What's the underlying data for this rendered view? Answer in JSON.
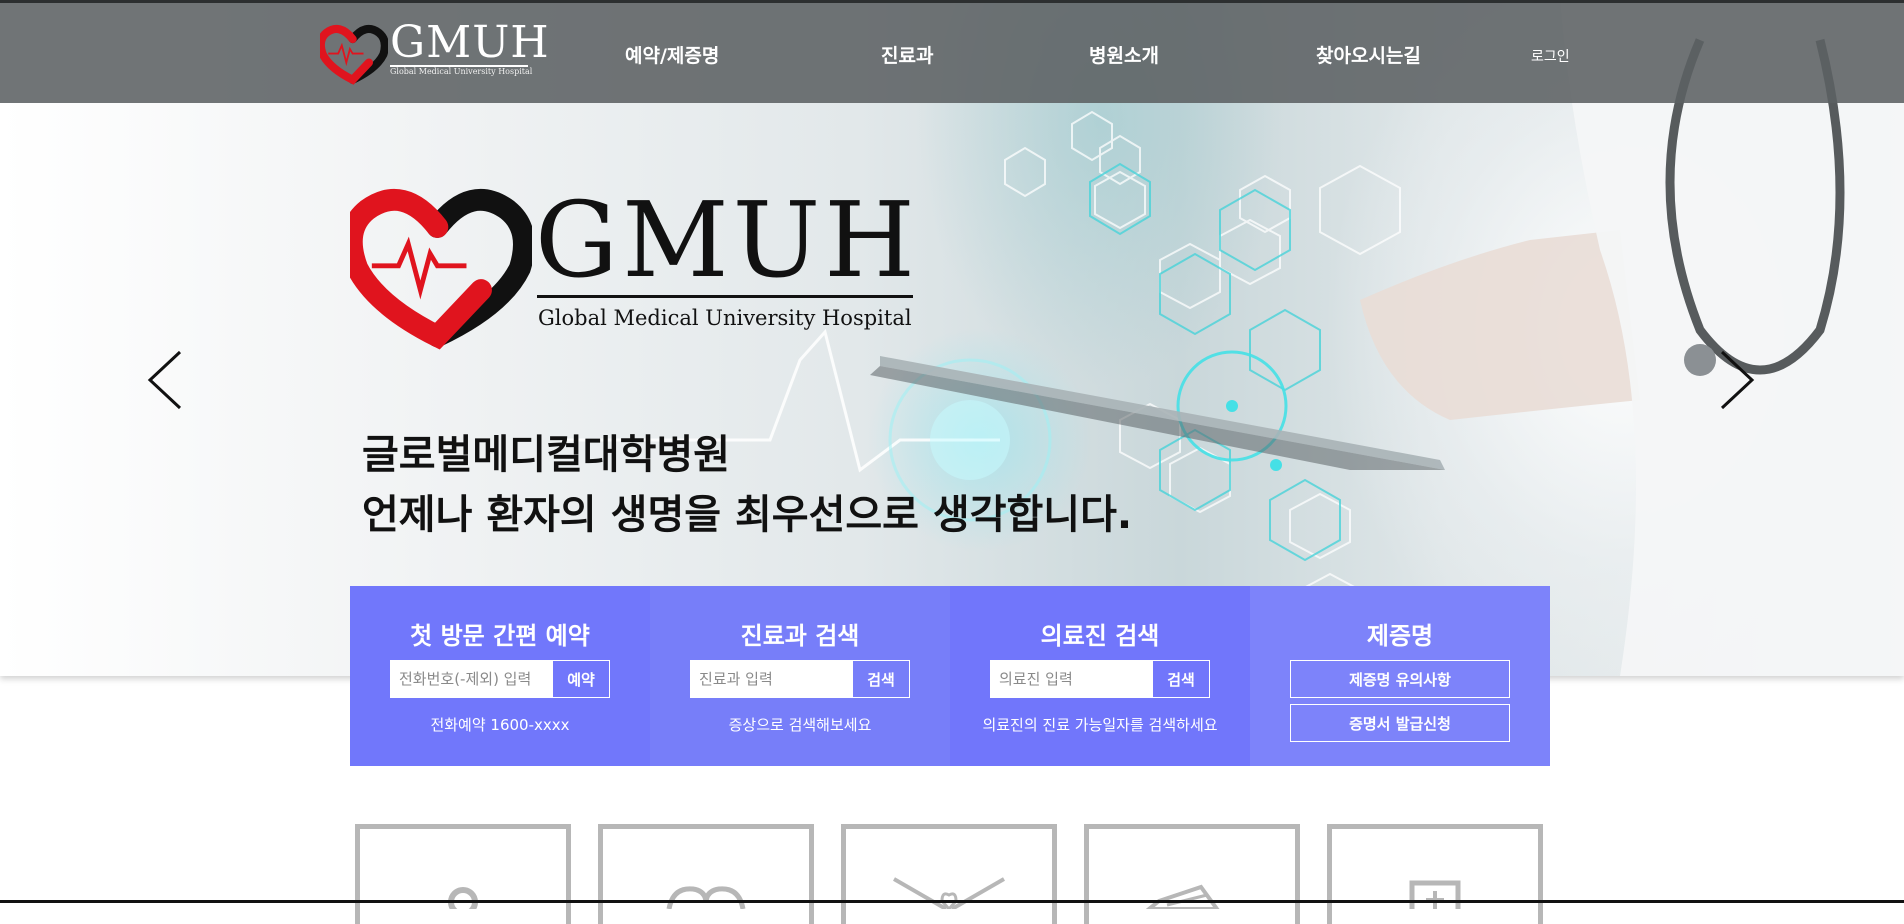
{
  "header": {
    "brand": "GMUH",
    "brand_tagline": "Global Medical University Hospital",
    "nav": [
      {
        "label": "예약/제증명"
      },
      {
        "label": "진료과"
      },
      {
        "label": "병원소개"
      },
      {
        "label": "찾아오시는길"
      }
    ],
    "login_label": "로그인"
  },
  "hero": {
    "brand": "GMUH",
    "brand_tagline": "Global Medical University Hospital",
    "headline_line1": "글로벌메디컬대학병원",
    "headline_line2": "언제나 환자의 생명을 최우선으로 생각합니다."
  },
  "quick_panel": {
    "first_visit": {
      "title": "첫 방문 간편 예약",
      "placeholder": "전화번호(-제외) 입력",
      "button": "예약",
      "note": "전화예약 1600-xxxx"
    },
    "department_search": {
      "title": "진료과 검색",
      "placeholder": "진료과 입력",
      "button": "검색",
      "note": "증상으로 검색해보세요"
    },
    "doctor_search": {
      "title": "의료진 검색",
      "placeholder": "의료진 입력",
      "button": "검색",
      "note": "의료진의 진료 가능일자를 검색하세요"
    },
    "certificates": {
      "title": "제증명",
      "button1": "제증명 유의사항",
      "button2": "증명서 발급신청"
    }
  },
  "colors": {
    "header_bg": "#5c6163",
    "panel_blue": "#7177fb",
    "logo_red": "#e0141e",
    "logo_black": "#111111",
    "tile_border": "#b7b7b7"
  },
  "icons": {
    "prev": "chevron-left-icon",
    "next": "chevron-right-icon",
    "tiles": [
      "person-pin-icon",
      "heart-icon",
      "heart-envelope-icon",
      "documents-icon",
      "medical-kit-icon"
    ]
  }
}
